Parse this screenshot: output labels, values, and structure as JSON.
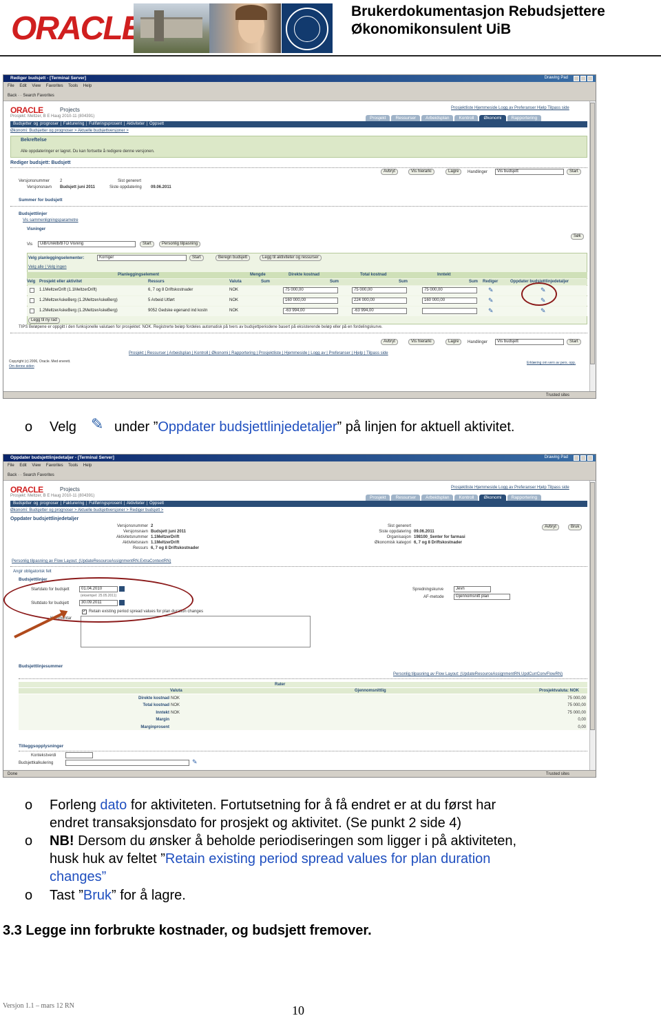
{
  "header": {
    "title_line1": "Brukerdokumentasjon Rebudsjettere",
    "title_line2": "Økonomikonsulent UiB",
    "logo_text": "ORACLE"
  },
  "shot1": {
    "window_title": "Rediger budsjett - [Terminal Server]",
    "menu": "File Edit View Favorites Tools Help",
    "toolbar": "Back  ·  ·  Search  Favorites",
    "drawing_pad": "Drawing Pad",
    "app_name": "Projects",
    "project_line": "Prosjekt: Meltzer, B E Haug 2010-11 (804391)",
    "top_links": "Prosjektliste  Hjemmeside  Logg av  Preferanser  Hjelp  Tilpass side",
    "tabs": [
      "Prosjekt",
      "Ressurser",
      "Arbeidsplan",
      "Kontroll",
      "Økonomi",
      "Rapportering"
    ],
    "nav": "Budsjetter og prognoser | Fakturering | Fullføringsprosent | Aktiviteter | Oppsett",
    "breadcrumb": "Økonomi: Budsjetter og prognoser > Aktuelle budsjettversjoner >",
    "confirm_title": "Bekreftelse",
    "confirm_text": "Alle oppdateringer er lagret. Du kan fortsette å redigere denne versjonen.",
    "page_title": "Rediger budsjett: Budsjett",
    "ver_label": "Versjonsnummer",
    "ver_value": "2",
    "vername_label": "Versjonsnavn",
    "vername_value": "Budsjett juni 2011",
    "gen_label": "Sist generert",
    "upd_label": "Siste oppdatering",
    "upd_value": "09.06.2011",
    "btn_cancel": "Avbryt",
    "btn_hierarchy": "Vis hierarki",
    "btn_save": "Lagre",
    "actions_label": "Handlinger",
    "actions_value": "Vis budsjett",
    "btn_start": "Start",
    "summary_link": "Summer for budsjett",
    "lines_title": "Budsjettlinjer",
    "compare_link": "Vis sammenligningsparametre",
    "views_title": "Visninger",
    "view_label": "Vis",
    "view_value": "UiB/Uniklb/BTO Visning",
    "btn_personal": "Personlig tilpasning",
    "btn_search": "Søk",
    "plan_label": "Velg planleggingselementer:",
    "plan_value": "Korriger",
    "btn_calc": "Beregn budsjett",
    "btn_add_act": "Legg til aktiviteter og ressurser",
    "select_all": "Velg alle | Velg ingen",
    "col_plan": "Planleggingselement",
    "col_qty": "Mengde",
    "col_direct": "Direkte kostnad",
    "col_total": "Total kostnad",
    "col_income": "Inntekt",
    "col_select": "Velg",
    "col_project": "Prosjekt eller aktivitet",
    "col_resources": "Ressurs",
    "col_currency": "Valuta",
    "col_sum": "Sum",
    "col_edit": "Rediger",
    "col_update": "Oppdater budsjettlinjedetaljer",
    "rows": [
      {
        "project": "1.1MeltzerDrift (1.1MeltzerDrift)",
        "resource": "6, 7 og 8 Driftskostnader",
        "currency": "NOK",
        "direct": "75 000,00",
        "total": "75 000,00",
        "income": "75 000,00"
      },
      {
        "project": "1.2MeltzerAskeBerg (1.2MeltzerAskeBerg)",
        "resource": "5 Arbeid Utført",
        "currency": "NOK",
        "direct": "160 000,00",
        "total": "224 000,00",
        "income": "160 000,00"
      },
      {
        "project": "1.2MeltzerAskeBerg (1.2MeltzerAskeBerg)",
        "resource": "9052 Gedske egenand ind kostn",
        "currency": "NOK",
        "direct": "-63 994,00",
        "total": "-63 994,00",
        "income": ""
      }
    ],
    "btn_add_row": "Legg til ny rad",
    "tips": "TIPS Beløpene er oppgitt i den funksjonelle valutaen for prosjektet: NOK. Registrerte beløp fordeles automatisk på tvers av budsjettperiodene basert på eksisterende beløp eller på en fordelingskurve.",
    "bottom_links": "Prosjekt | Ressurser | Arbeidsplan | Kontroll | Økonomi | Rapportering | Prosjektliste | Hjemmeside | Logg av | Preferanser | Hjelp | Tilpass side",
    "copyright": "Copyright (c) 2006, Oracle. Med enerett.",
    "about": "Om denne siden",
    "privacy": "Erklæring om vern av pers. opp.",
    "status": "Trusted sites"
  },
  "caption1": {
    "bullet": "o",
    "before": "Velg",
    "middle": "under ”",
    "link": "Oppdater budsjettlinjedetaljer",
    "after": "” på linjen for aktuell aktivitet."
  },
  "shot2": {
    "window_title": "Oppdater budsjettlinjedetaljer - [Terminal Server]",
    "page_title": "Oppdater budsjettlinjedetaljer",
    "breadcrumb": "Økonomi: Budsjetter og prognoser > Aktuelle budsjettversjoner > Rediger budsjett >",
    "btn_cancel": "Avbryt",
    "btn_use": "Bruk",
    "info_left_labels": [
      "Versjonsnummer",
      "Versjonsnavn",
      "Aktivitetsnummer",
      "Aktivitetsnavn",
      "Ressurs"
    ],
    "info_left_values": [
      "2",
      "Budsjett juni 2011",
      "1.1MeltzerDrift",
      "1.1MeltzerDrift",
      "6, 7 og 8 Driftskostnader"
    ],
    "info_right_labels": [
      "Sist generert",
      "Siste oppdatering",
      "Organisasjon",
      "Økonomisk kategori"
    ],
    "info_right_values": [
      "",
      "09.06.2011",
      "198100_Senter for farmasi",
      "6, 7 og 8 Driftskostnader"
    ],
    "personal_link": "Personlig tilpasning av Flow Layout: (UpdateResourceAssignmentRN.ExtraContextRN)",
    "required": "Angir obligatorisk felt",
    "lines_title": "Budsjettlinjer",
    "start_label": "Startdato for budsjett",
    "start_value": "01.04.2010",
    "start_example": "(eksempel: 25.05.2011)",
    "end_label": "Sluttdato for budsjett",
    "end_value": "30.09.2011",
    "retain_label": "Retain existing period spread values for plan duration changes",
    "comment_label": "Kommentar",
    "spread_label": "Spredningskurve",
    "spread_value": "Jevn",
    "af_label": "AF-metode",
    "af_value": "Gjennomsnitt plan",
    "summary_title": "Budsjettlinjesummer",
    "summary_link": "Personlig tilpasning av Flow Layout: (UpdateResourceAssignmentRN.UpdCurrConvFlowRN)",
    "col_rates": "Rater",
    "col_currency": "Valuta",
    "col_avg": "Gjennomsnittlig",
    "col_projcur": "Prosjektvaluta: NOK",
    "sum_rows": [
      {
        "label": "Direkte kostnad",
        "cur": "NOK",
        "value": "75 000,00"
      },
      {
        "label": "Total kostnad",
        "cur": "NOK",
        "value": "75 000,00"
      },
      {
        "label": "Inntekt",
        "cur": "NOK",
        "value": "75 000,00"
      },
      {
        "label": "Margin",
        "cur": "",
        "value": "0,00"
      },
      {
        "label": "Marginprosent",
        "cur": "",
        "value": "0,00"
      }
    ],
    "extra_title": "Tilleggsopplysninger",
    "context_label": "Kontekstverdi",
    "calc_label": "Budsjettkalkulering",
    "status_left": "Done",
    "status": "Trusted sites"
  },
  "instructions": [
    {
      "bullet": "o",
      "parts": [
        "Forleng ",
        "dato",
        " for aktiviteten. Fortutsetning for å få endret er at du først har"
      ],
      "line2": "endret transaksjonsdato for prosjekt og aktivitet. (Se punkt 2 side 4)"
    },
    {
      "bullet": "o",
      "nb": "NB!",
      "text": " Dersom du ønsker å beholde periodiseringen som ligger i på aktiviteten,",
      "line2a": "husk huk av feltet ”",
      "line2b": "Retain existing period spread values for plan duration",
      "line3a": "changes",
      "line3b": "”"
    },
    {
      "bullet": "o",
      "a": "Tast ”",
      "b": "Bruk",
      "c": "” for å lagre."
    }
  ],
  "section_heading": "3.3 Legge inn forbrukte kostnader, og budsjett fremover.",
  "footer": {
    "version": "Versjon 1.1 – mars 12 RN",
    "page": "10"
  },
  "colors": {
    "oracle_red": "#d01f1f",
    "link_blue": "#1f4fbf",
    "oracle_navy": "#2a4d77",
    "annotation_red": "#8b1a1a"
  }
}
